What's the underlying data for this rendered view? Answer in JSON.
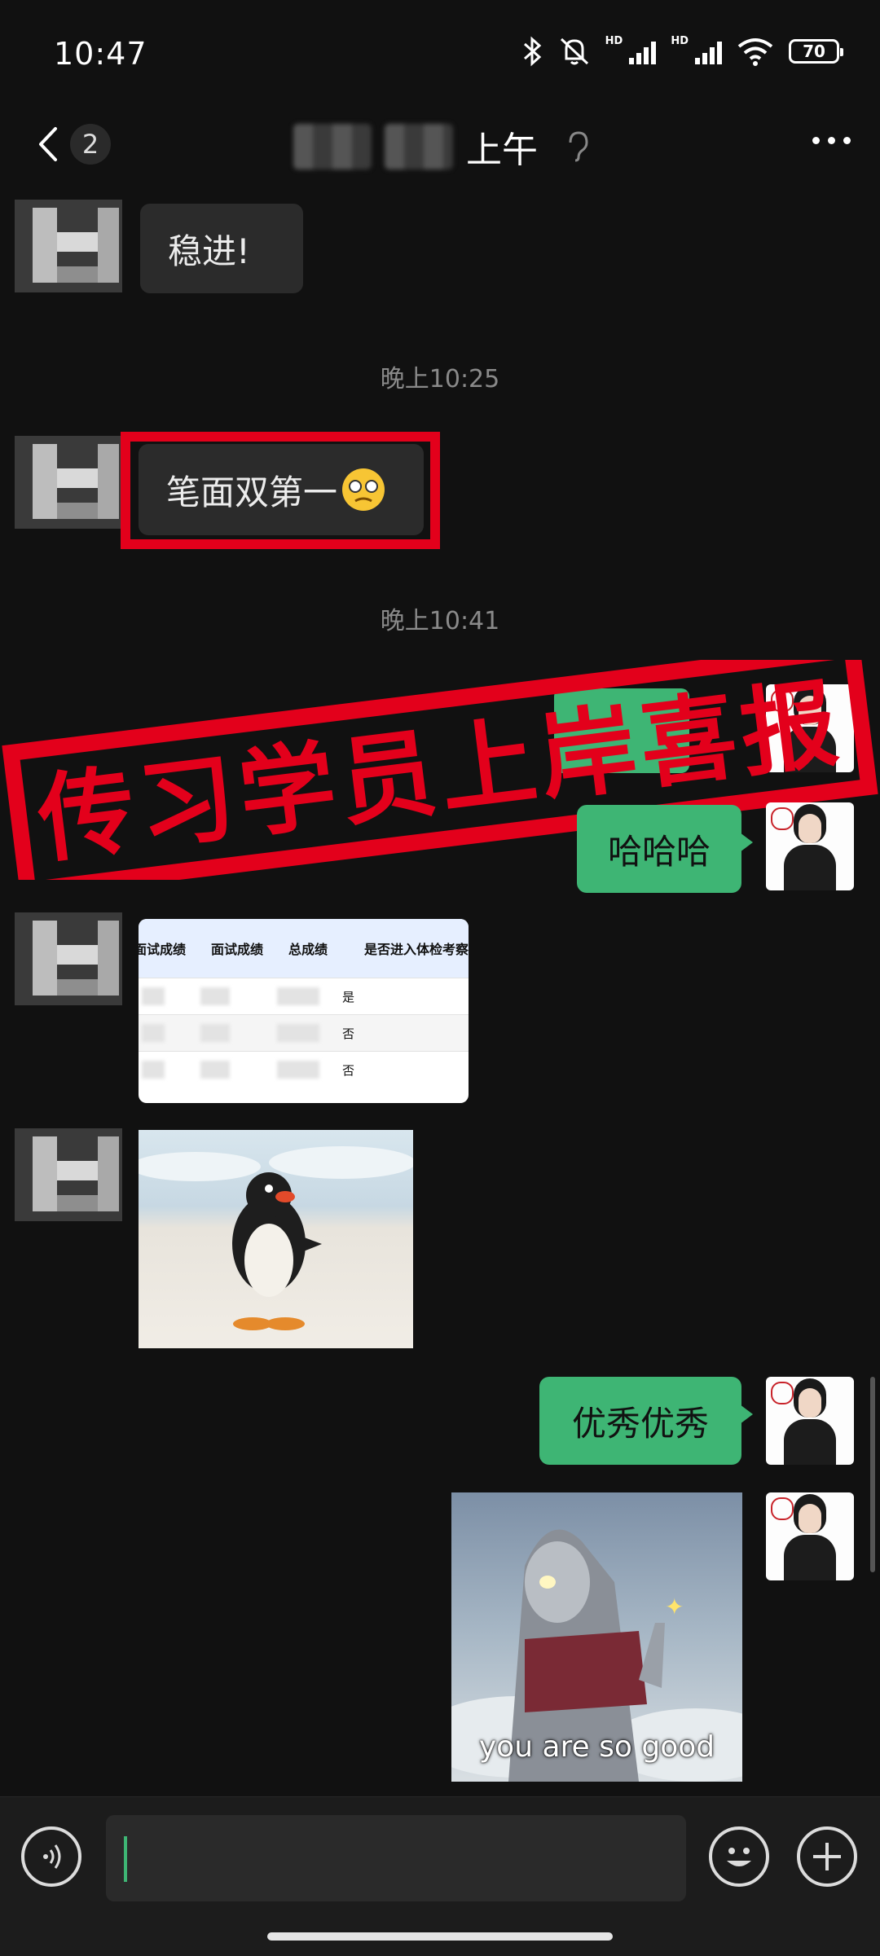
{
  "status_bar": {
    "time": "10:47",
    "battery": "70",
    "hd1": "HD",
    "hd2": "HD"
  },
  "header": {
    "unread_count": "2",
    "title": "上午"
  },
  "messages": {
    "m1": "稳进!",
    "ts1": "晚上10:25",
    "m2": "笔面双第一",
    "ts2": "晚上10:41",
    "m3": "哈哈哈",
    "m4": "优秀优秀",
    "sticker_caption": "you are so good"
  },
  "table_card": {
    "columns": [
      "面试成绩",
      "面试成绩",
      "总成绩",
      "是否进入体检考察"
    ],
    "rows": [
      [
        "是"
      ],
      [
        "否"
      ],
      [
        "否"
      ]
    ]
  },
  "banner": {
    "text": "传习学员上岸喜报"
  },
  "colors": {
    "accent_green": "#3eb574",
    "banner_red": "#e3001b"
  },
  "input": {
    "value": ""
  }
}
